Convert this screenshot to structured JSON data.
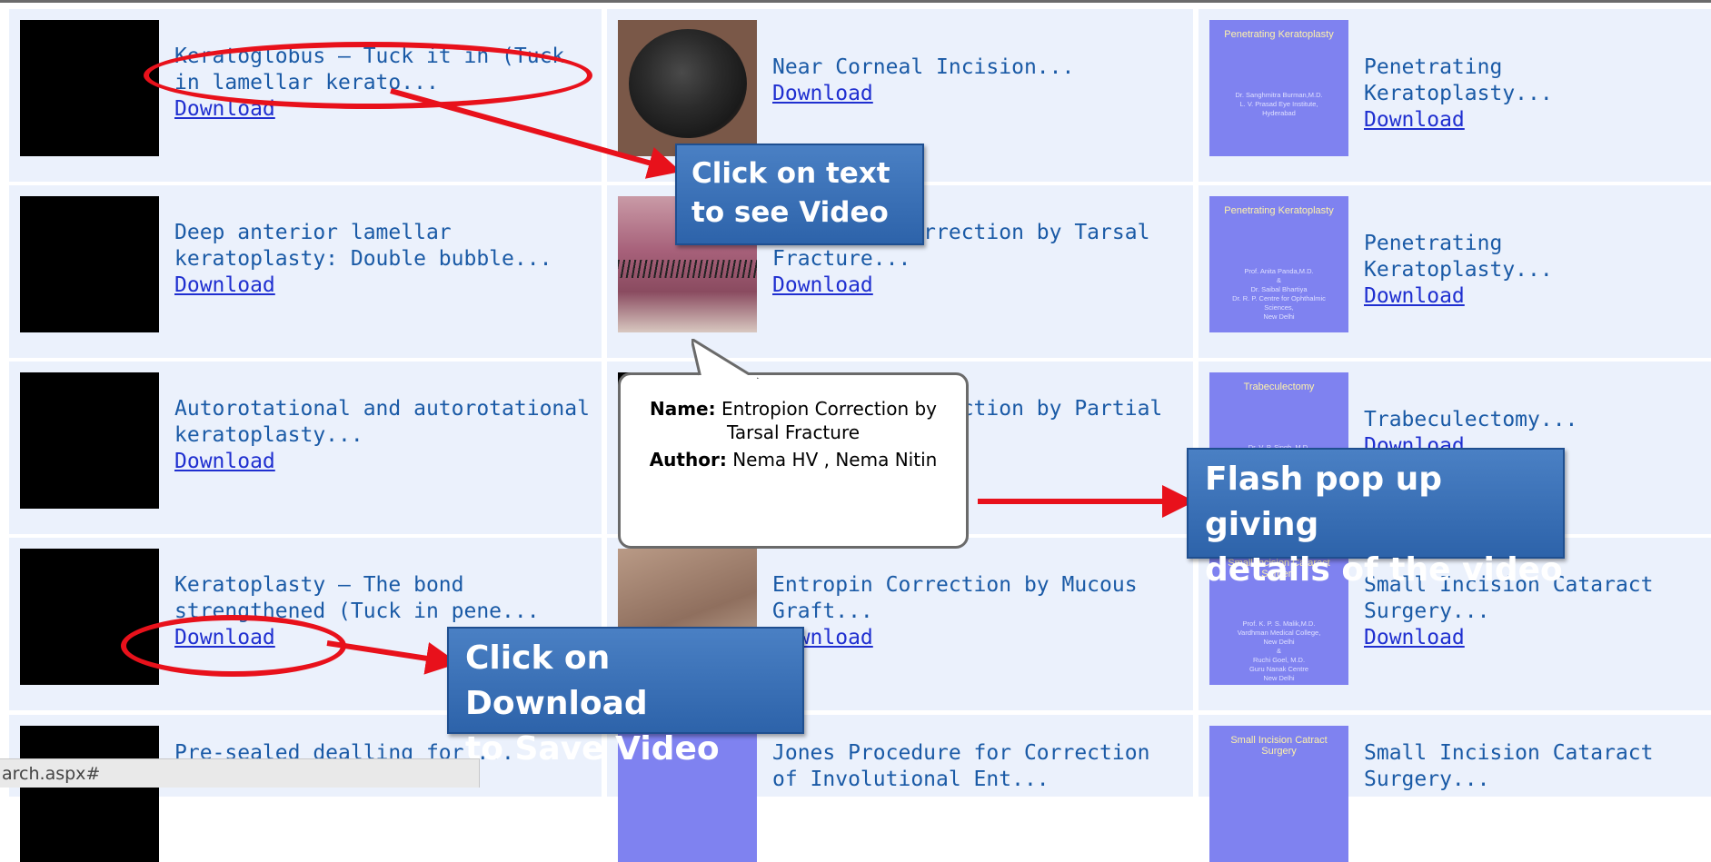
{
  "rows": [
    [
      {
        "title": "Keratoglobus — Tuck it in (Tuck in lamellar kerato...",
        "download": "Download",
        "thumb": "black"
      },
      {
        "title": "Near Corneal Incision...",
        "download": "Download",
        "thumb": "eye"
      },
      {
        "title": "Penetrating Keratoplasty...",
        "download": "Download",
        "thumb": "purple",
        "thumb_title": "Penetrating Keratoplasty",
        "thumb_body": [
          "Dr. Sanghmitra Burman,M.D.",
          "L. V. Prasad Eye Institute,",
          "Hyderabad"
        ]
      }
    ],
    [
      {
        "title": "Deep anterior lamellar keratoplasty: Double bubble...",
        "download": "Download",
        "thumb": "black"
      },
      {
        "title": "Entropion Correction by Tarsal Fracture...",
        "download": "Download",
        "thumb": "lid"
      },
      {
        "title": "Penetrating Keratoplasty...",
        "download": "Download",
        "thumb": "purple",
        "thumb_title": "Penetrating Keratoplasty",
        "thumb_body": [
          "Prof. Anita Panda,M.D.",
          "&",
          "Dr. Saibal Bhartiya",
          "Dr. R. P. Centre for Ophthalmic",
          "Sciences,",
          "New Delhi"
        ]
      }
    ],
    [
      {
        "title": "Autorotational and autorotational keratoplasty...",
        "download": "Download",
        "thumb": "black"
      },
      {
        "title": "Entropion Correction by Partial Tarsectomy...",
        "download": "Download",
        "thumb": "black"
      },
      {
        "title": "Trabeculectomy...",
        "download": "Download",
        "thumb": "purple",
        "thumb_title": "Trabeculectomy",
        "thumb_body": [
          "Dr. V. P. Singh, M.D."
        ]
      }
    ],
    [
      {
        "title": "Keratoplasty — The bond strengthened (Tuck in pene...",
        "download": "Download",
        "thumb": "black"
      },
      {
        "title": "Entropin Correction by Mucous Graft...",
        "download": "Download",
        "thumb": "mucous"
      },
      {
        "title": "Small Incision Cataract Surgery...",
        "download": "Download",
        "thumb": "purple",
        "thumb_title": "Small Incision Cataract Surgery",
        "thumb_body": [
          "Prof. K. P. S. Malik,M.D.",
          "Vardhman Medical College,",
          "New Delhi",
          "&",
          "Ruchi Goel, M.D.",
          "Guru Nanak Centre",
          "New Delhi"
        ]
      }
    ],
    [
      {
        "title": "Pre-sealed dealling for ... neoiridic",
        "download": "",
        "thumb": "black"
      },
      {
        "title": "Jones Procedure for Correction of Involutional Ent...",
        "download": "",
        "thumb": "purple-plain"
      },
      {
        "title": "Small Incision Cataract Surgery...",
        "download": "",
        "thumb": "purple",
        "thumb_title": "Small Incision Catract Surgery",
        "thumb_body": []
      }
    ]
  ],
  "tooltip": {
    "name_label": "Name:",
    "name_value": "Entropion Correction by Tarsal Fracture",
    "author_label": "Author:",
    "author_value": "Nema HV , Nema Nitin"
  },
  "annotations": {
    "callout_video": [
      "Click on text",
      "to see Video"
    ],
    "callout_flash": [
      "Flash pop up giving",
      "details of the video"
    ],
    "callout_save": [
      "Click on Download",
      "to Save Video"
    ],
    "colors": {
      "arrow": "#e8111b",
      "callout": "#2d63aa"
    }
  },
  "status_bar": {
    "text": "arch.aspx#"
  }
}
